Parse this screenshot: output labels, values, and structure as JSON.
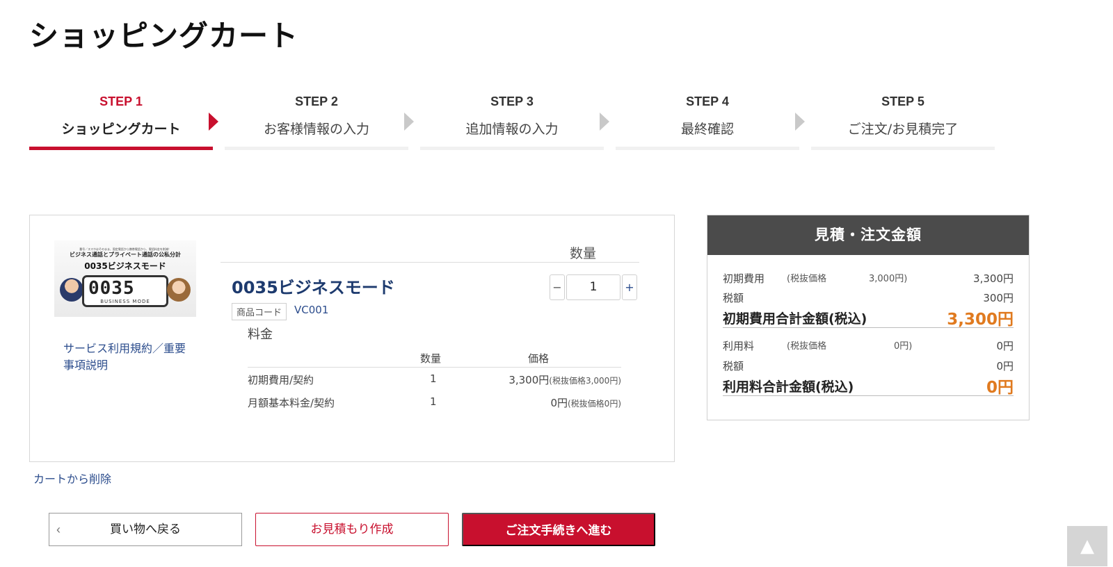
{
  "page": {
    "title": "ショッピングカート"
  },
  "steps": [
    {
      "num": "STEP 1",
      "label": "ショッピングカート",
      "active": true
    },
    {
      "num": "STEP 2",
      "label": "お客様情報の入力",
      "active": false
    },
    {
      "num": "STEP 3",
      "label": "追加情報の入力",
      "active": false
    },
    {
      "num": "STEP 4",
      "label": "最終確認",
      "active": false
    },
    {
      "num": "STEP 5",
      "label": "ご注文/お見積完了",
      "active": false
    }
  ],
  "product": {
    "image": {
      "line1": "番号／スマホはそのまま、固定電話から携帯電話から、電話料金を削減！",
      "line2": "ビジネス通話とプライベート通話の公私分計",
      "line3": "0035ビジネスモード",
      "digits": "0035",
      "mode": "BUSINESS MODE"
    },
    "terms_link": "サービス利用規約／重要事項説明",
    "qty_header": "数量",
    "name": "0035ビジネスモード",
    "quantity": "1",
    "minus": "−",
    "plus": "+",
    "code_label": "商品コード",
    "code": "VC001",
    "fee_title": "料金",
    "fee_table": {
      "qty_header": "数量",
      "price_header": "価格",
      "rows": [
        {
          "name": "初期費用/契約",
          "qty": "1",
          "price": "3,300円",
          "note": "(税抜価格3,000円)"
        },
        {
          "name": "月額基本料金/契約",
          "qty": "1",
          "price": "0円",
          "note": "(税抜価格0円)"
        }
      ]
    },
    "delete_link": "カートから削除"
  },
  "summary": {
    "title": "見積・注文金額",
    "initial": {
      "label": "初期費用",
      "pretax_label": "(税抜価格",
      "pretax_value": "3,000円)",
      "amount": "3,300円",
      "tax_label": "税額",
      "tax": "300円",
      "total_label": "初期費用合計金額(税込)",
      "total": "3,300円"
    },
    "usage": {
      "label": "利用料",
      "pretax_label": "(税抜価格",
      "pretax_value": "0円)",
      "amount": "0円",
      "tax_label": "税額",
      "tax": "0円",
      "total_label": "利用料合計金額(税込)",
      "total": "0円"
    },
    "accent_color": "#e07a1f"
  },
  "buttons": {
    "back": "買い物へ戻る",
    "back_icon": "‹",
    "quote": "お見積もり作成",
    "order": "ご注文手続きへ進む"
  },
  "scroll_top": {
    "icon": "▲"
  },
  "colors": {
    "brand": "#c8102e",
    "link": "#2b4c8c",
    "header_bg": "#4b4b4b"
  }
}
